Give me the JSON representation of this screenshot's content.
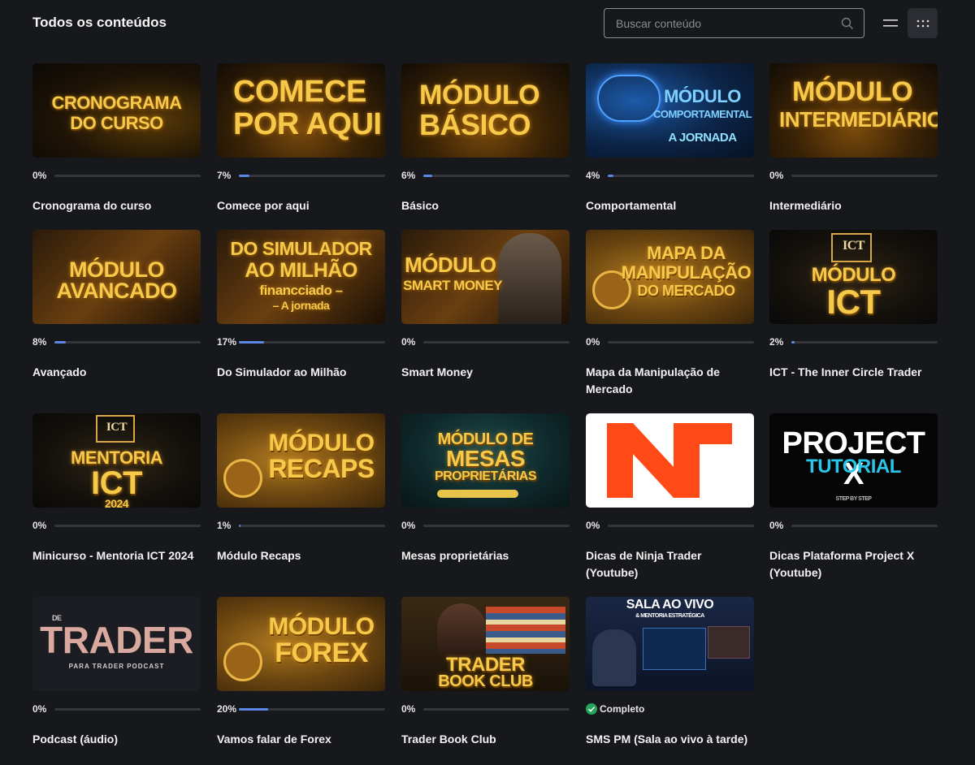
{
  "header": {
    "title": "Todos os conteúdos",
    "search_placeholder": "Buscar conteúdo",
    "search_icon": "search-icon",
    "view_list_icon": "list-view-icon",
    "view_grid_icon": "grid-view-icon"
  },
  "colors": {
    "background": "#17181c",
    "progress_fill": "#5b87e6",
    "progress_track": "#34363c",
    "complete": "#22a55a"
  },
  "cards": [
    {
      "title": "Cronograma do curso",
      "progress_label": "0%",
      "progress": 0,
      "thumb_lines": [
        "CRONOGRAMA",
        "DO CURSO"
      ]
    },
    {
      "title": "Comece por aqui",
      "progress_label": "7%",
      "progress": 7,
      "thumb_lines": [
        "COMECE",
        "POR AQUI"
      ]
    },
    {
      "title": "Básico",
      "progress_label": "6%",
      "progress": 6,
      "thumb_lines": [
        "MÓDULO",
        "BÁSICO"
      ]
    },
    {
      "title": "Comportamental",
      "progress_label": "4%",
      "progress": 4,
      "thumb_lines": [
        "MÓDULO",
        "COMPORTAMENTAL",
        "A JORNADA"
      ]
    },
    {
      "title": "Intermediário",
      "progress_label": "0%",
      "progress": 0,
      "thumb_lines": [
        "MÓDULO",
        "INTERMEDIÁRIO"
      ]
    },
    {
      "title": "Avançado",
      "progress_label": "8%",
      "progress": 8,
      "thumb_lines": [
        "MÓDULO",
        "AVANCADO"
      ]
    },
    {
      "title": "Do Simulador ao Milhão",
      "progress_label": "17%",
      "progress": 17,
      "thumb_lines": [
        "DO SIMULADOR",
        "AO MILHÃO",
        "financciado –",
        "– A jornada"
      ]
    },
    {
      "title": "Smart Money",
      "progress_label": "0%",
      "progress": 0,
      "thumb_lines": [
        "MÓDULO",
        "SMART MONEY"
      ]
    },
    {
      "title": "Mapa da Manipulação de Mercado",
      "progress_label": "0%",
      "progress": 0,
      "thumb_lines": [
        "MAPA DA",
        "MANIPULAÇÃO",
        "DO MERCADO"
      ]
    },
    {
      "title": "ICT - The Inner Circle Trader",
      "progress_label": "2%",
      "progress": 2,
      "thumb_lines": [
        "ICT",
        "MÓDULO",
        "ICT"
      ]
    },
    {
      "title": "Minicurso - Mentoria ICT 2024",
      "progress_label": "0%",
      "progress": 0,
      "thumb_lines": [
        "ICT",
        "MENTORIA",
        "ICT",
        "2024"
      ]
    },
    {
      "title": "Módulo Recaps",
      "progress_label": "1%",
      "progress": 1,
      "thumb_lines": [
        "MÓDULO",
        "RECAPS"
      ]
    },
    {
      "title": "Mesas proprietárias",
      "progress_label": "0%",
      "progress": 0,
      "thumb_lines": [
        "MÓDULO DE",
        "MESAS",
        "PROPRIETÁRIAS"
      ]
    },
    {
      "title": "Dicas de Ninja Trader (Youtube)",
      "progress_label": "0%",
      "progress": 0,
      "thumb_lines": []
    },
    {
      "title": "Dicas Plataforma Project X (Youtube)",
      "progress_label": "0%",
      "progress": 0,
      "thumb_lines": [
        "PROJECT X",
        "TUTORIAL",
        "STEP BY STEP"
      ]
    },
    {
      "title": "Podcast (áudio)",
      "progress_label": "0%",
      "progress": 0,
      "thumb_lines": [
        "DE",
        "TRADER",
        "PARA TRADER PODCAST"
      ]
    },
    {
      "title": "Vamos falar de Forex",
      "progress_label": "20%",
      "progress": 20,
      "thumb_lines": [
        "MÓDULO",
        "FOREX"
      ]
    },
    {
      "title": "Trader Book Club",
      "progress_label": "0%",
      "progress": 0,
      "thumb_lines": [
        "TRADER",
        "BOOK CLUB"
      ]
    },
    {
      "title": "SMS PM (Sala ao vivo à tarde)",
      "progress_label": "Completo",
      "progress": 100,
      "completed": true,
      "thumb_lines": [
        "SALA AO VIVO",
        "& MENTORIA ESTRATÉGICA"
      ]
    }
  ]
}
